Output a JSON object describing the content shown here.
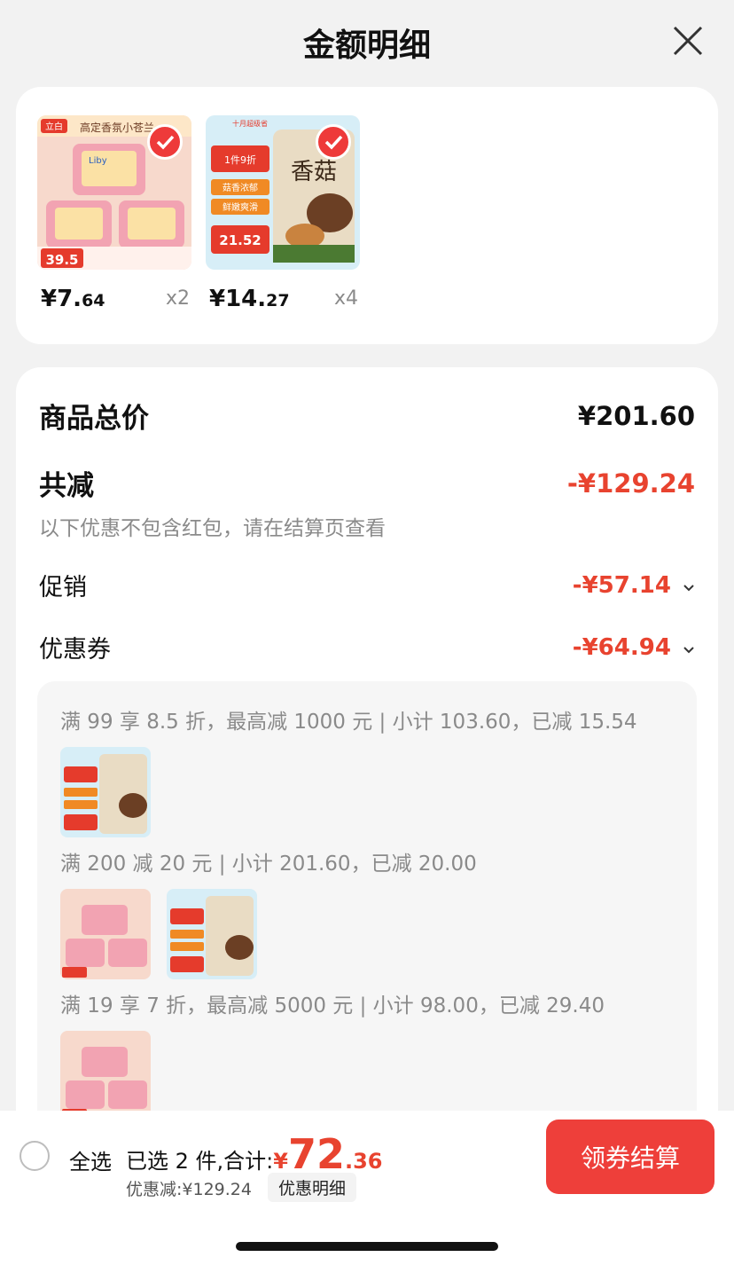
{
  "header": {
    "title": "金额明细"
  },
  "products": [
    {
      "price_int": "¥7.",
      "price_dec": "64",
      "qty": "x2",
      "thumb_badge": "立白",
      "thumb_title": "高定香氛小苍兰",
      "thumb_brand": "Liby",
      "thumb_price": "39.5"
    },
    {
      "price_int": "¥14.",
      "price_dec": "27",
      "qty": "x4",
      "thumb_badge": "十月超级省",
      "thumb_title": "香菇",
      "thumb_promo1": "1件9折",
      "thumb_promo2": "菇香浓郁",
      "thumb_promo3": "鲜嫩爽滑",
      "thumb_price": "21.52"
    }
  ],
  "summary": {
    "total_label": "商品总价",
    "total_value": "¥201.60",
    "reduce_label": "共减",
    "reduce_value": "-¥129.24",
    "note": "以下优惠不包含红包，请在结算页查看",
    "promo_label": "促销",
    "promo_value": "-¥57.14",
    "coupon_label": "优惠券",
    "coupon_value": "-¥64.94"
  },
  "coupons": [
    {
      "text": "满 99 享 8.5 折，最高减 1000 元 | 小计 103.60，已减 15.54"
    },
    {
      "text": "满 200 减 20 元 | 小计 201.60，已减 20.00"
    },
    {
      "text": "满 19 享 7 折，最高减 5000 元 | 小计 98.00，已减 29.40"
    }
  ],
  "bottom": {
    "select_all": "全选",
    "selected_text": "已选 2 件,合计:",
    "yen": "¥",
    "total_int": "72",
    "total_dec": ".36",
    "discount_text": "优惠减:¥129.24",
    "detail_pill": "优惠明细",
    "checkout": "领券结算"
  },
  "colors": {
    "accent_red": "#e8432f",
    "button_red": "#ee3f3a"
  }
}
